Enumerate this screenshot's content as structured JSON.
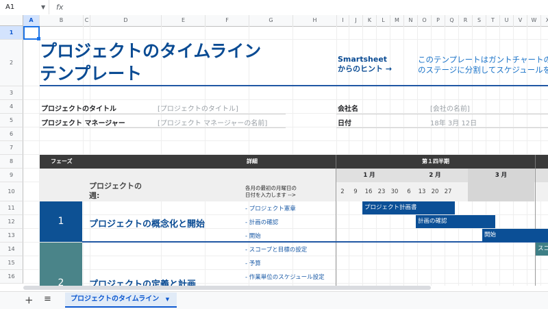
{
  "formula_bar": {
    "cell_ref": "A1",
    "fx": "fx"
  },
  "columns": [
    "A",
    "B",
    "C",
    "D",
    "E",
    "F",
    "G",
    "H",
    "I",
    "J",
    "K",
    "L",
    "M",
    "N",
    "O",
    "P",
    "Q",
    "R",
    "S",
    "T",
    "U",
    "V",
    "W",
    "X"
  ],
  "rows": [
    "1",
    "2",
    "3",
    "4",
    "5",
    "6",
    "7",
    "8",
    "9",
    "10",
    "11",
    "12",
    "13",
    "14",
    "15",
    "16"
  ],
  "title": {
    "line1": "プロジェクトのタイムライン",
    "line2": "テンプレート"
  },
  "hint": {
    "label1": "Smartsheet",
    "label2": "からのヒント →",
    "text1": "このテンプレートはガントチャートの",
    "text2": "のステージに分割してスケジュールを"
  },
  "fields": {
    "project_title_label": "プロジェクトのタイトル",
    "project_title_value": "[プロジェクトのタイトル]",
    "manager_label": "プロジェクト マネージャー",
    "manager_value": "[プロジェクト マネージャーの名前]",
    "company_label": "会社名",
    "company_value": "[会社の名前]",
    "date_label": "日付",
    "date_value": "18年 3月 12日"
  },
  "table": {
    "phase_header": "フェーズ",
    "detail_header": "詳細",
    "quarter_header": "第１四半期",
    "week_label_1": "プロジェクトの",
    "week_label_2": "週:",
    "date_hint_1": "各月の最初の月曜日の",
    "date_hint_2": "日付を入力します -->",
    "months": [
      "1 月",
      "2 月",
      "3 月"
    ],
    "dates": [
      "2",
      "9",
      "16",
      "23",
      "30",
      "6",
      "13",
      "20",
      "27"
    ]
  },
  "phases": [
    {
      "num": "1",
      "name": "プロジェクトの概念化と開始",
      "tasks": [
        "- プロジェクト憲章",
        "- 計画の確認",
        "- 開始"
      ]
    },
    {
      "num": "2",
      "name": "プロジェクトの定義と計画",
      "tasks": [
        "- スコープと目標の設定",
        "- 予算",
        "- 作業単位のスケジュール設定"
      ]
    }
  ],
  "bars": [
    "プロジェクト計画書",
    "計画の確認",
    "開始",
    "スコ"
  ],
  "sheet_tab": {
    "name": "プロジェクトのタイムライン",
    "add": "+",
    "list": "≡"
  },
  "colors": {
    "accent": "#0a4b93",
    "phase1": "#0d5194",
    "phase2": "#4a8489",
    "bar": "#0b4f96"
  }
}
